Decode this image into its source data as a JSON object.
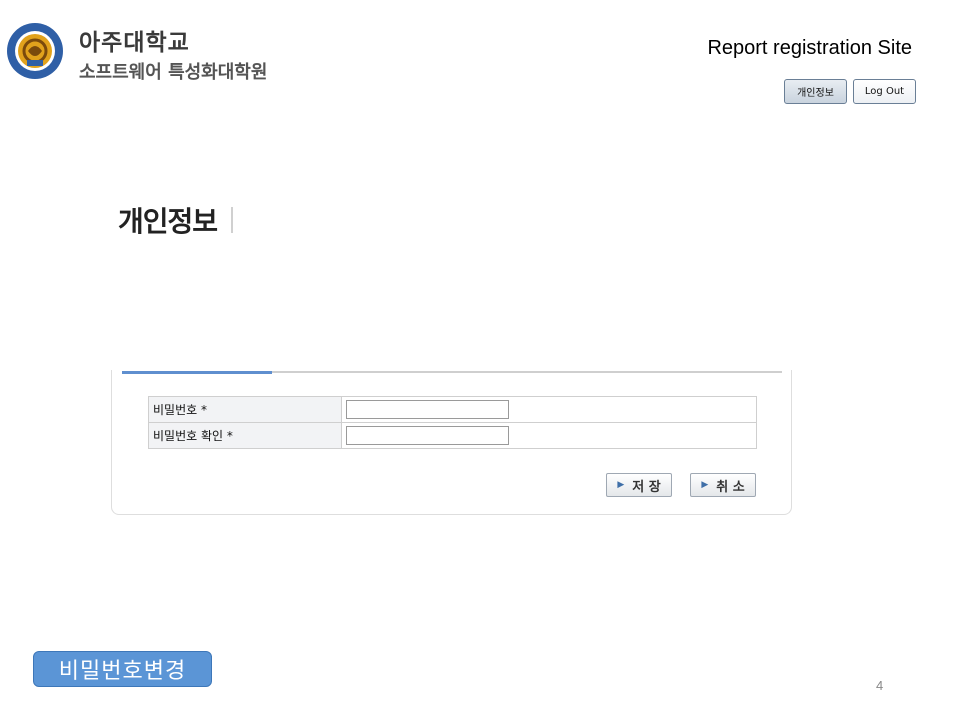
{
  "header": {
    "logo": {
      "university_name": "아주대학교",
      "department_name": "소프트웨어 특성화대학원",
      "emblem_ring_text": "AJOU UNIVERSITY",
      "emblem_year": "1973",
      "emblem_colors": {
        "ring": "#2f5fa6",
        "center": "#e1a21c"
      }
    },
    "site_title": "Report registration Site",
    "buttons": {
      "profile_label": "개인정보",
      "logout_label": "Log Out"
    }
  },
  "main": {
    "section_title": "개인정보",
    "form": {
      "rows": [
        {
          "label": "비밀번호 *",
          "value": ""
        },
        {
          "label": "비밀번호 확인 *",
          "value": ""
        }
      ]
    },
    "actions": {
      "save_label": "저 장",
      "cancel_label": "취 소"
    }
  },
  "footer": {
    "slide_badge": "비밀번호변경",
    "page_number": "4"
  },
  "colors": {
    "accent": "#5f8fcf",
    "badge_bg": "#5b95d6",
    "button_arrow": "#3f6fa8"
  }
}
